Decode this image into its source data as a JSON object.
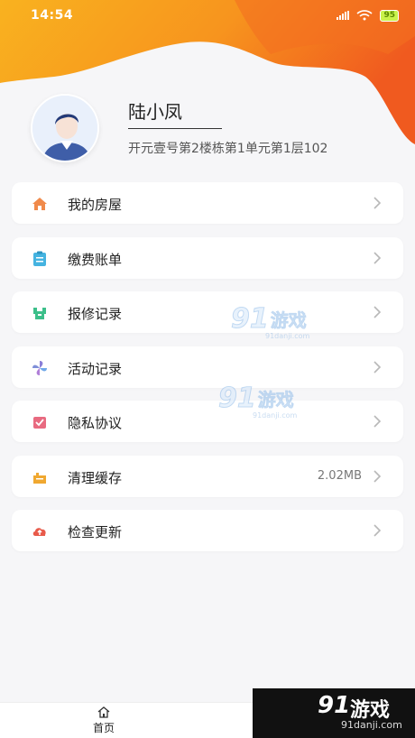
{
  "status_bar": {
    "time": "14:54",
    "battery": "95"
  },
  "profile": {
    "name": "陆小凤",
    "address": "开元壹号第2楼栋第1单元第1层102"
  },
  "menu": {
    "items": [
      {
        "label": "我的房屋",
        "icon": "house-icon",
        "color": "#f08a4b"
      },
      {
        "label": "缴费账单",
        "icon": "bill-icon",
        "color": "#45b3e0"
      },
      {
        "label": "报修记录",
        "icon": "repair-icon",
        "color": "#3cbf8a"
      },
      {
        "label": "活动记录",
        "icon": "pinwheel-icon",
        "color": "#8b7fd8"
      },
      {
        "label": "隐私协议",
        "icon": "privacy-icon",
        "color": "#e86a80"
      },
      {
        "label": "清理缓存",
        "icon": "cache-icon",
        "color": "#f0a830",
        "value": "2.02MB"
      },
      {
        "label": "检查更新",
        "icon": "update-icon",
        "color": "#e85a4a"
      }
    ]
  },
  "bottom_nav": {
    "home_label": "首页"
  },
  "watermarks": {
    "brand_digits": "91",
    "brand_name": "游戏",
    "brand_site": "91danji.com"
  },
  "colors": {
    "header_orange": "#f7a51c",
    "header_red": "#f2541d",
    "background": "#f6f6f8"
  }
}
